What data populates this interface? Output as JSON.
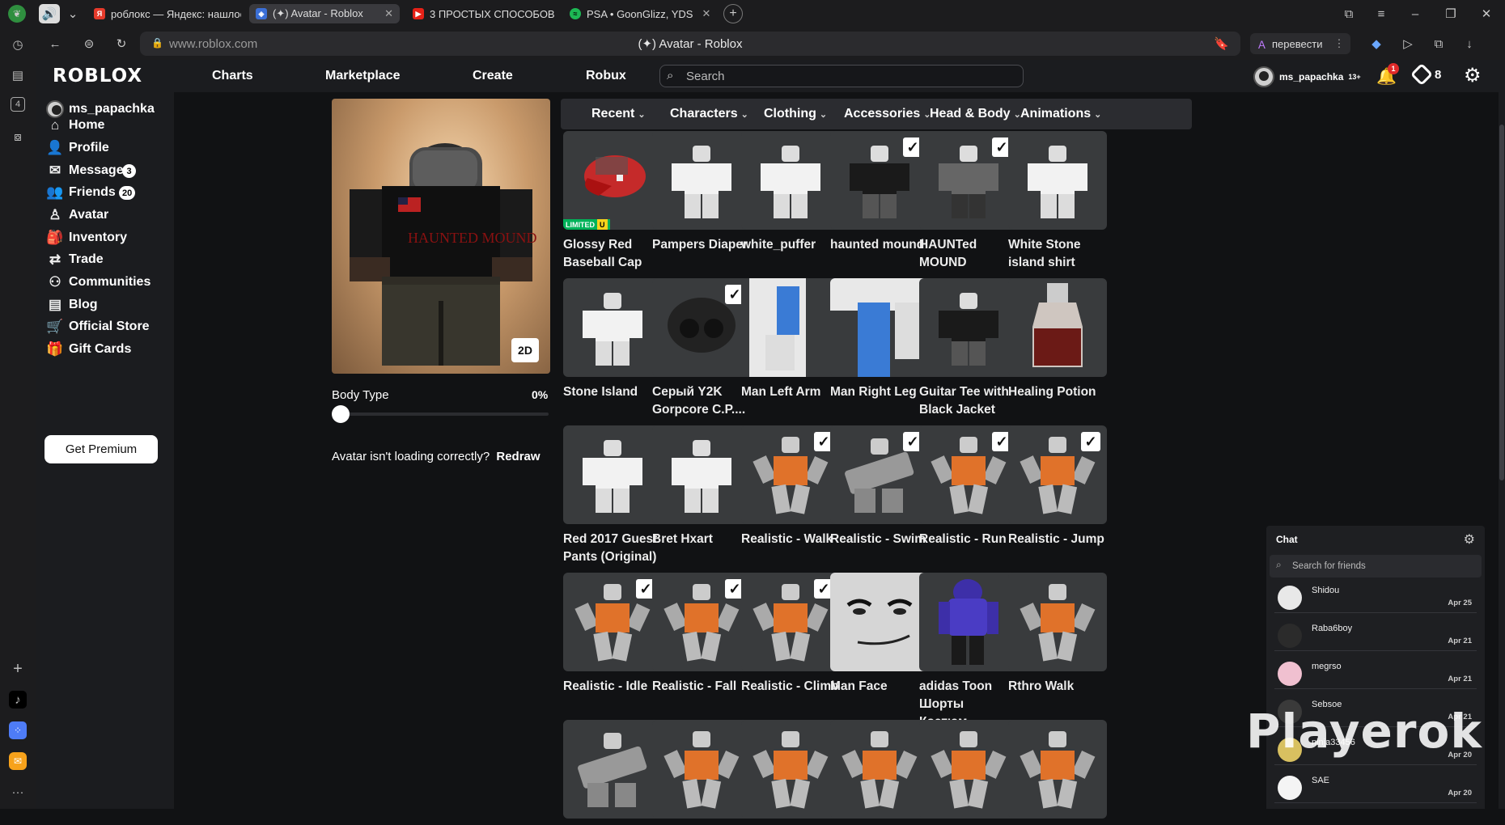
{
  "browser": {
    "tabs": [
      {
        "title": "роблокс — Яндекс: нашлось"
      },
      {
        "title": "(✦) Avatar - Roblox"
      },
      {
        "title": "3 ПРОСТЫХ СПОСОБОВ"
      },
      {
        "title": "PSA • GoonGlizz, YDS"
      }
    ],
    "url": "www.roblox.com",
    "page_title": "(✦) Avatar - Roblox",
    "translate_label": "перевести"
  },
  "header": {
    "logo": "ROBLOX",
    "nav": [
      "Charts",
      "Marketplace",
      "Create",
      "Robux"
    ],
    "search_placeholder": "Search",
    "username": "ms_papachka",
    "age_badge": "13+",
    "notification_count": "1",
    "robux_count": "8"
  },
  "sidebar": {
    "username": "ms_papachka",
    "items": [
      {
        "label": "Home",
        "icon": "home-icon"
      },
      {
        "label": "Profile",
        "icon": "profile-icon"
      },
      {
        "label": "Messages",
        "icon": "messages-icon",
        "badge": "3"
      },
      {
        "label": "Friends",
        "icon": "friends-icon",
        "badge": "20"
      },
      {
        "label": "Avatar",
        "icon": "avatar-icon"
      },
      {
        "label": "Inventory",
        "icon": "inventory-icon"
      },
      {
        "label": "Trade",
        "icon": "trade-icon"
      },
      {
        "label": "Communities",
        "icon": "communities-icon"
      },
      {
        "label": "Blog",
        "icon": "blog-icon"
      },
      {
        "label": "Official Store",
        "icon": "store-icon"
      },
      {
        "label": "Gift Cards",
        "icon": "gift-card-icon"
      }
    ],
    "premium_button": "Get Premium"
  },
  "avatar_panel": {
    "view_toggle": "2D",
    "body_type_label": "Body Type",
    "body_type_value": "0%",
    "redraw_text": "Avatar isn't loading correctly?",
    "redraw_link": "Redraw"
  },
  "categories": [
    "Recent",
    "Characters",
    "Clothing",
    "Accessories",
    "Head & Body",
    "Animations"
  ],
  "items": [
    {
      "name": "Glossy Red Baseball Cap",
      "checked": false,
      "limited": true,
      "thumb": "cap"
    },
    {
      "name": "Pampers Diaper",
      "checked": false,
      "thumb": "figure-white"
    },
    {
      "name": "white_puffer",
      "checked": false,
      "thumb": "figure-white"
    },
    {
      "name": "haunted mound",
      "checked": true,
      "thumb": "figure-black"
    },
    {
      "name": "HAUNTed MOUND",
      "checked": true,
      "thumb": "figure-grey"
    },
    {
      "name": "White Stone island shirt",
      "checked": false,
      "thumb": "figure-white"
    },
    {
      "name": "Stone Island",
      "checked": false,
      "thumb": "figure-white"
    },
    {
      "name": "Серый Y2K Gorpcore C.P....",
      "checked": true,
      "thumb": "beanie"
    },
    {
      "name": "Man Left Arm",
      "checked": false,
      "thumb": "arm"
    },
    {
      "name": "Man Right Leg",
      "checked": false,
      "thumb": "leg"
    },
    {
      "name": "Guitar Tee with Black Jacket",
      "checked": false,
      "thumb": "figure-black"
    },
    {
      "name": "Healing Potion",
      "checked": false,
      "thumb": "potion"
    },
    {
      "name": "Red 2017 Guest Pants (Original)",
      "checked": false,
      "thumb": "figure-white"
    },
    {
      "name": "Bret Hxart",
      "checked": false,
      "thumb": "figure-white"
    },
    {
      "name": "Realistic - Walk",
      "checked": true,
      "thumb": "anim"
    },
    {
      "name": "Realistic - Swim",
      "checked": true,
      "thumb": "anim-grey"
    },
    {
      "name": "Realistic - Run",
      "checked": true,
      "thumb": "anim"
    },
    {
      "name": "Realistic - Jump",
      "checked": true,
      "thumb": "anim"
    },
    {
      "name": "Realistic - Idle",
      "checked": true,
      "thumb": "anim"
    },
    {
      "name": "Realistic - Fall",
      "checked": true,
      "thumb": "anim"
    },
    {
      "name": "Realistic - Climb",
      "checked": true,
      "thumb": "anim"
    },
    {
      "name": "Man Face",
      "checked": false,
      "thumb": "face"
    },
    {
      "name": "adidas Toon Шорты Костюм...",
      "checked": false,
      "thumb": "hoodie"
    },
    {
      "name": "Rthro Walk",
      "checked": false,
      "thumb": "anim"
    },
    {
      "name": "",
      "checked": false,
      "thumb": "anim-grey"
    },
    {
      "name": "",
      "checked": false,
      "thumb": "anim"
    },
    {
      "name": "",
      "checked": false,
      "thumb": "anim"
    },
    {
      "name": "",
      "checked": false,
      "thumb": "anim"
    },
    {
      "name": "",
      "checked": false,
      "thumb": "anim"
    },
    {
      "name": "",
      "checked": false,
      "thumb": "anim"
    }
  ],
  "chat": {
    "title": "Chat",
    "search_placeholder": "Search for friends",
    "conversations": [
      {
        "name": "Shidou",
        "date": "Apr 25"
      },
      {
        "name": "Raba6boy",
        "date": "Apr 21"
      },
      {
        "name": "megrso",
        "date": "Apr 21"
      },
      {
        "name": "Sebsoe",
        "date": "Apr 21"
      },
      {
        "name": "ninja33456",
        "date": "Apr 20"
      },
      {
        "name": "SAE",
        "date": "Apr 20"
      }
    ]
  },
  "watermark": "Playerok",
  "colors": {
    "page_bg": "#111214",
    "panel_bg": "#1b1c1f",
    "tile_bg": "#393b3d",
    "limited_green": "#00b259"
  }
}
